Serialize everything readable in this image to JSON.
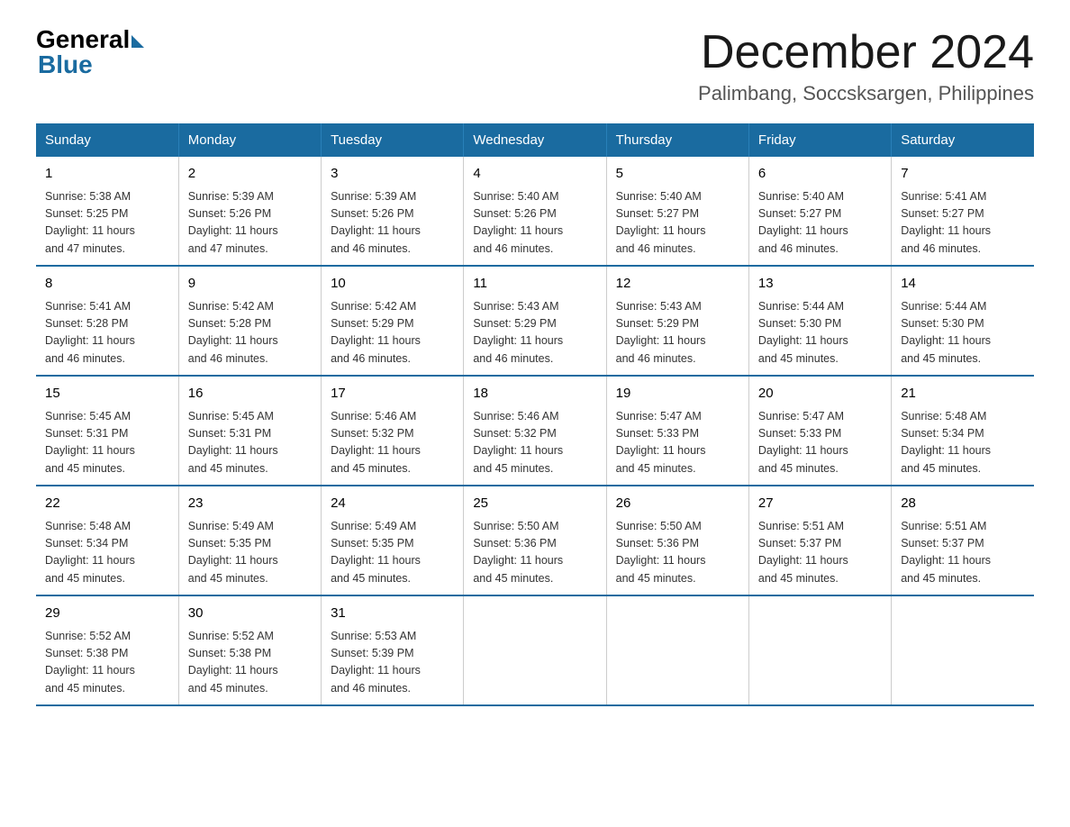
{
  "logo": {
    "general": "General",
    "blue": "Blue"
  },
  "header": {
    "month": "December 2024",
    "location": "Palimbang, Soccsksargen, Philippines"
  },
  "days_of_week": [
    "Sunday",
    "Monday",
    "Tuesday",
    "Wednesday",
    "Thursday",
    "Friday",
    "Saturday"
  ],
  "weeks": [
    [
      {
        "day": "1",
        "info": "Sunrise: 5:38 AM\nSunset: 5:25 PM\nDaylight: 11 hours\nand 47 minutes."
      },
      {
        "day": "2",
        "info": "Sunrise: 5:39 AM\nSunset: 5:26 PM\nDaylight: 11 hours\nand 47 minutes."
      },
      {
        "day": "3",
        "info": "Sunrise: 5:39 AM\nSunset: 5:26 PM\nDaylight: 11 hours\nand 46 minutes."
      },
      {
        "day": "4",
        "info": "Sunrise: 5:40 AM\nSunset: 5:26 PM\nDaylight: 11 hours\nand 46 minutes."
      },
      {
        "day": "5",
        "info": "Sunrise: 5:40 AM\nSunset: 5:27 PM\nDaylight: 11 hours\nand 46 minutes."
      },
      {
        "day": "6",
        "info": "Sunrise: 5:40 AM\nSunset: 5:27 PM\nDaylight: 11 hours\nand 46 minutes."
      },
      {
        "day": "7",
        "info": "Sunrise: 5:41 AM\nSunset: 5:27 PM\nDaylight: 11 hours\nand 46 minutes."
      }
    ],
    [
      {
        "day": "8",
        "info": "Sunrise: 5:41 AM\nSunset: 5:28 PM\nDaylight: 11 hours\nand 46 minutes."
      },
      {
        "day": "9",
        "info": "Sunrise: 5:42 AM\nSunset: 5:28 PM\nDaylight: 11 hours\nand 46 minutes."
      },
      {
        "day": "10",
        "info": "Sunrise: 5:42 AM\nSunset: 5:29 PM\nDaylight: 11 hours\nand 46 minutes."
      },
      {
        "day": "11",
        "info": "Sunrise: 5:43 AM\nSunset: 5:29 PM\nDaylight: 11 hours\nand 46 minutes."
      },
      {
        "day": "12",
        "info": "Sunrise: 5:43 AM\nSunset: 5:29 PM\nDaylight: 11 hours\nand 46 minutes."
      },
      {
        "day": "13",
        "info": "Sunrise: 5:44 AM\nSunset: 5:30 PM\nDaylight: 11 hours\nand 45 minutes."
      },
      {
        "day": "14",
        "info": "Sunrise: 5:44 AM\nSunset: 5:30 PM\nDaylight: 11 hours\nand 45 minutes."
      }
    ],
    [
      {
        "day": "15",
        "info": "Sunrise: 5:45 AM\nSunset: 5:31 PM\nDaylight: 11 hours\nand 45 minutes."
      },
      {
        "day": "16",
        "info": "Sunrise: 5:45 AM\nSunset: 5:31 PM\nDaylight: 11 hours\nand 45 minutes."
      },
      {
        "day": "17",
        "info": "Sunrise: 5:46 AM\nSunset: 5:32 PM\nDaylight: 11 hours\nand 45 minutes."
      },
      {
        "day": "18",
        "info": "Sunrise: 5:46 AM\nSunset: 5:32 PM\nDaylight: 11 hours\nand 45 minutes."
      },
      {
        "day": "19",
        "info": "Sunrise: 5:47 AM\nSunset: 5:33 PM\nDaylight: 11 hours\nand 45 minutes."
      },
      {
        "day": "20",
        "info": "Sunrise: 5:47 AM\nSunset: 5:33 PM\nDaylight: 11 hours\nand 45 minutes."
      },
      {
        "day": "21",
        "info": "Sunrise: 5:48 AM\nSunset: 5:34 PM\nDaylight: 11 hours\nand 45 minutes."
      }
    ],
    [
      {
        "day": "22",
        "info": "Sunrise: 5:48 AM\nSunset: 5:34 PM\nDaylight: 11 hours\nand 45 minutes."
      },
      {
        "day": "23",
        "info": "Sunrise: 5:49 AM\nSunset: 5:35 PM\nDaylight: 11 hours\nand 45 minutes."
      },
      {
        "day": "24",
        "info": "Sunrise: 5:49 AM\nSunset: 5:35 PM\nDaylight: 11 hours\nand 45 minutes."
      },
      {
        "day": "25",
        "info": "Sunrise: 5:50 AM\nSunset: 5:36 PM\nDaylight: 11 hours\nand 45 minutes."
      },
      {
        "day": "26",
        "info": "Sunrise: 5:50 AM\nSunset: 5:36 PM\nDaylight: 11 hours\nand 45 minutes."
      },
      {
        "day": "27",
        "info": "Sunrise: 5:51 AM\nSunset: 5:37 PM\nDaylight: 11 hours\nand 45 minutes."
      },
      {
        "day": "28",
        "info": "Sunrise: 5:51 AM\nSunset: 5:37 PM\nDaylight: 11 hours\nand 45 minutes."
      }
    ],
    [
      {
        "day": "29",
        "info": "Sunrise: 5:52 AM\nSunset: 5:38 PM\nDaylight: 11 hours\nand 45 minutes."
      },
      {
        "day": "30",
        "info": "Sunrise: 5:52 AM\nSunset: 5:38 PM\nDaylight: 11 hours\nand 45 minutes."
      },
      {
        "day": "31",
        "info": "Sunrise: 5:53 AM\nSunset: 5:39 PM\nDaylight: 11 hours\nand 46 minutes."
      },
      {
        "day": "",
        "info": ""
      },
      {
        "day": "",
        "info": ""
      },
      {
        "day": "",
        "info": ""
      },
      {
        "day": "",
        "info": ""
      }
    ]
  ]
}
